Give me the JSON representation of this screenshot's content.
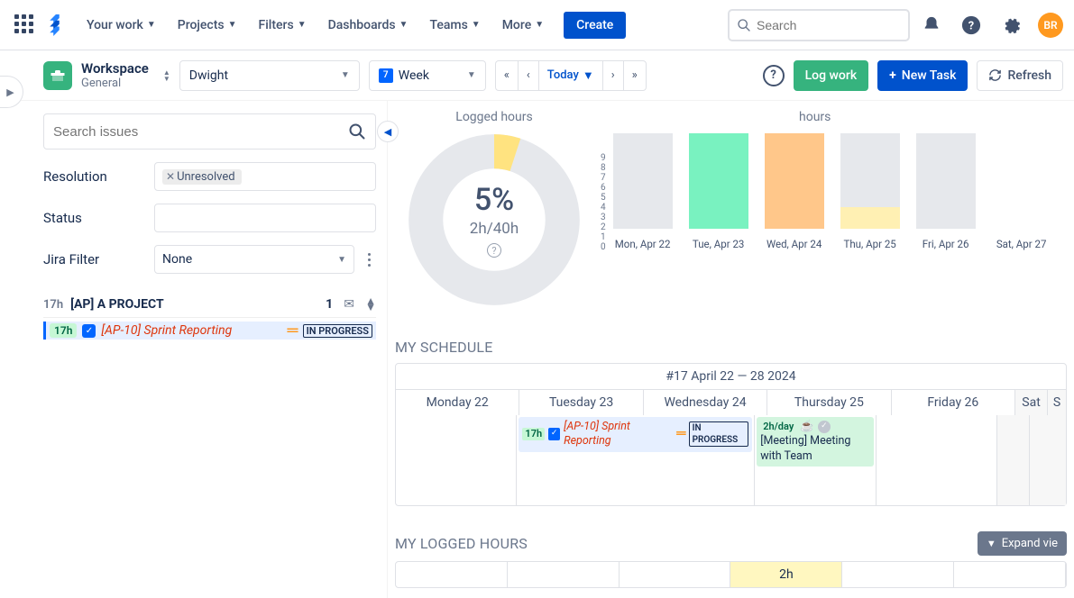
{
  "topnav": {
    "items": [
      "Your work",
      "Projects",
      "Filters",
      "Dashboards",
      "Teams",
      "More"
    ],
    "create": "Create",
    "search_placeholder": "Search",
    "avatar_initials": "BR"
  },
  "toolbar": {
    "workspace_title": "Workspace",
    "workspace_subtitle": "General",
    "user_select": "Dwight",
    "view_select": "Week",
    "view_icon_text": "7",
    "today": "Today",
    "log_work": "Log work",
    "new_task": "New Task",
    "refresh": "Refresh"
  },
  "sidebar": {
    "search_placeholder": "Search issues",
    "filters": {
      "resolution_label": "Resolution",
      "resolution_tag": "Unresolved",
      "status_label": "Status",
      "jira_filter_label": "Jira Filter",
      "jira_filter_value": "None"
    },
    "project": {
      "estimate": "17h",
      "name": "[AP] A PROJECT",
      "count": "1"
    },
    "issue": {
      "estimate": "17h",
      "title": "[AP-10] Sprint Reporting",
      "status": "IN PROGRESS"
    }
  },
  "chart_data": [
    {
      "type": "pie",
      "title": "Logged hours",
      "percent_label": "5%",
      "sub_label": "2h/40h",
      "series": [
        {
          "name": "logged",
          "value": 2,
          "color": "#ffe380"
        },
        {
          "name": "remaining",
          "value": 38,
          "color": "#e6e8ec"
        }
      ]
    },
    {
      "type": "bar",
      "title": "hours",
      "ylim": [
        0,
        9
      ],
      "yticks": [
        9,
        8,
        7,
        6,
        5,
        4,
        3,
        2,
        1,
        0
      ],
      "categories": [
        "Mon, Apr 22",
        "Tue, Apr 23",
        "Wed, Apr 24",
        "Thu, Apr 25",
        "Fri, Apr 26",
        "Sat, Apr 27"
      ],
      "series": [
        {
          "name": "background",
          "color": "#e6e8ec",
          "values": [
            9,
            9,
            9,
            9,
            9,
            0
          ]
        },
        {
          "name": "green",
          "color": "#79f2c0",
          "values": [
            0,
            9,
            0,
            0,
            0,
            0
          ]
        },
        {
          "name": "orange",
          "color": "#ffc78a",
          "values": [
            0,
            0,
            9,
            0,
            0,
            0
          ]
        },
        {
          "name": "yellow",
          "color": "#fff0b3",
          "values": [
            0,
            0,
            0,
            2,
            0,
            0
          ]
        }
      ]
    }
  ],
  "schedule": {
    "title": "MY SCHEDULE",
    "range": "#17 April 22 — 28 2024",
    "days": [
      "Monday 22",
      "Tuesday 23",
      "Wednesday 24",
      "Thursday 25",
      "Friday 26",
      "Sat",
      "S"
    ],
    "tue_event": {
      "estimate": "17h",
      "title": "[AP-10] Sprint Reporting",
      "status": "IN PROGRESS"
    },
    "thu_event": {
      "rate": "2h/day",
      "title": "[Meeting] Meeting with Team"
    }
  },
  "logged": {
    "title": "MY LOGGED HOURS",
    "expand": "Expand vie",
    "cells": [
      "",
      "",
      "",
      "2h",
      "",
      ""
    ]
  }
}
